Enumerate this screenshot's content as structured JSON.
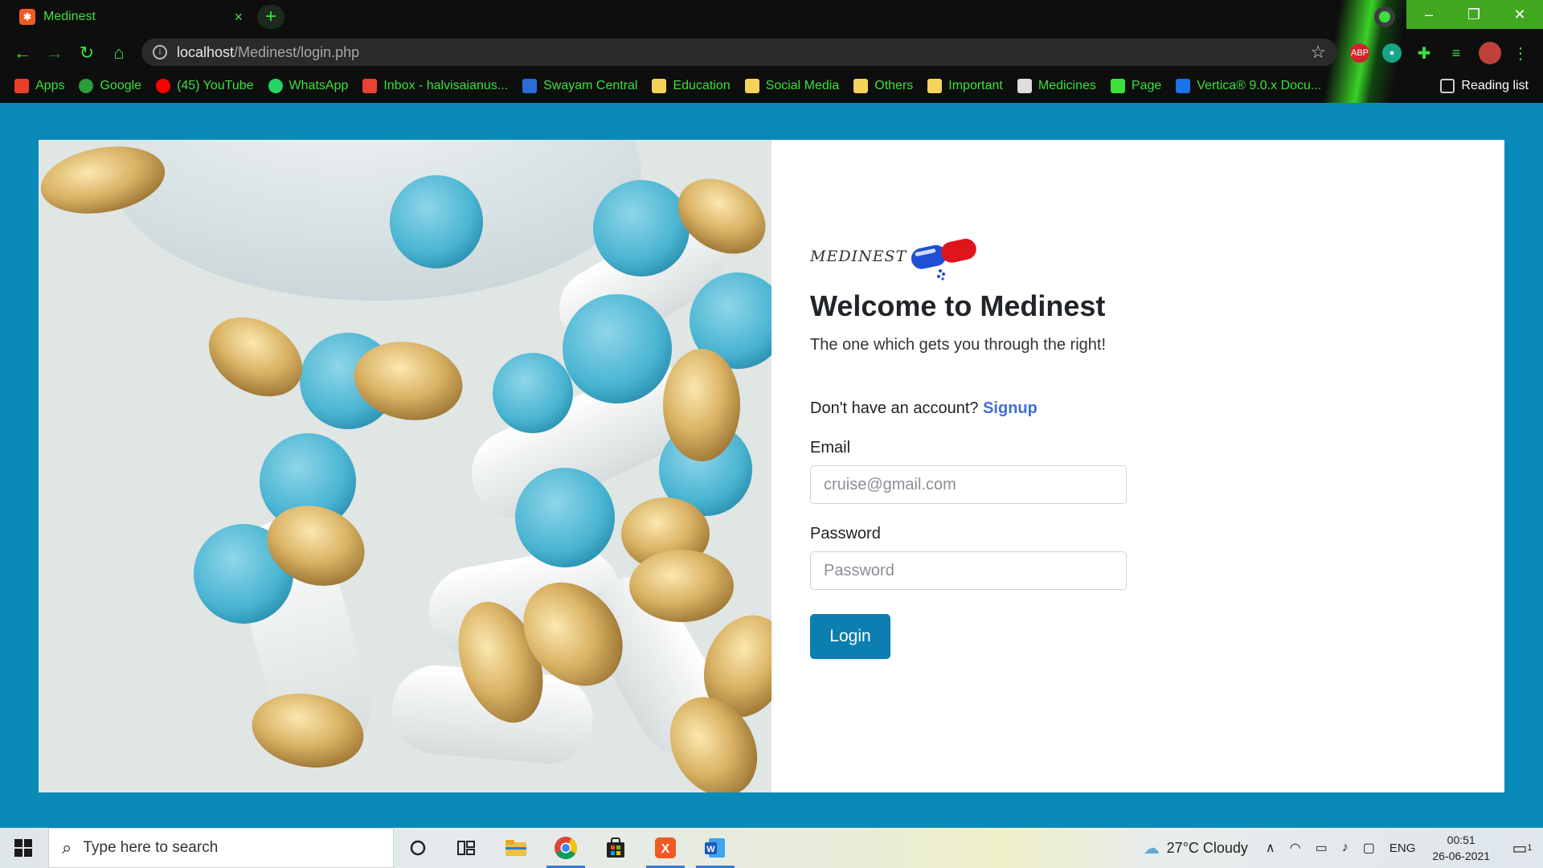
{
  "browser": {
    "tab_title": "Medinest",
    "tab_close": "×",
    "new_tab": "+",
    "window_min": "–",
    "window_max": "❐",
    "window_close": "✕",
    "url_host": "localhost",
    "url_path": "/Medinest/login.php",
    "extension_badge": "ABP",
    "bookmarks": [
      {
        "label": "Apps",
        "icon": "apps-grid-icon",
        "color": "#e8402a"
      },
      {
        "label": "Google",
        "icon": "google-icon",
        "color": "#2c9c3c"
      },
      {
        "label": "(45) YouTube",
        "icon": "youtube-icon",
        "color": "#ff0000"
      },
      {
        "label": "WhatsApp",
        "icon": "whatsapp-icon",
        "color": "#25d366"
      },
      {
        "label": "Inbox - halvisaianus...",
        "icon": "gmail-icon",
        "color": "#ea4335"
      },
      {
        "label": "Swayam Central",
        "icon": "swayam-icon",
        "color": "#2b6cd8"
      },
      {
        "label": "Education",
        "icon": "folder-icon",
        "color": "#f5d35a"
      },
      {
        "label": "Social Media",
        "icon": "folder-icon",
        "color": "#f5d35a"
      },
      {
        "label": "Others",
        "icon": "folder-icon",
        "color": "#f5d35a"
      },
      {
        "label": "Important",
        "icon": "folder-icon",
        "color": "#f5d35a"
      },
      {
        "label": "Medicines",
        "icon": "img-icon",
        "color": "#dddddd"
      },
      {
        "label": "Page",
        "icon": "wix-icon",
        "color": "#3ce03c"
      },
      {
        "label": "Vertica® 9.0.x Docu...",
        "icon": "vertica-icon",
        "color": "#1a73e8"
      }
    ],
    "reading_list": "Reading list"
  },
  "page": {
    "logo_text": "MEDINEST",
    "heading": "Welcome to Medinest",
    "tagline": "The one which gets you through the right!",
    "signup_prompt": "Don't have an account?",
    "signup_link": "Signup",
    "email_label": "Email",
    "email_placeholder": "cruise@gmail.com",
    "password_label": "Password",
    "password_placeholder": "Password",
    "login_button": "Login",
    "colors": {
      "background": "#0a8ab9",
      "button": "#0b7fb0",
      "link": "#3f6fd8"
    }
  },
  "taskbar": {
    "search_placeholder": "Type here to search",
    "weather": "27°C  Cloudy",
    "language": "ENG",
    "time": "00:51",
    "date": "26-06-2021",
    "notification_count": "1"
  }
}
